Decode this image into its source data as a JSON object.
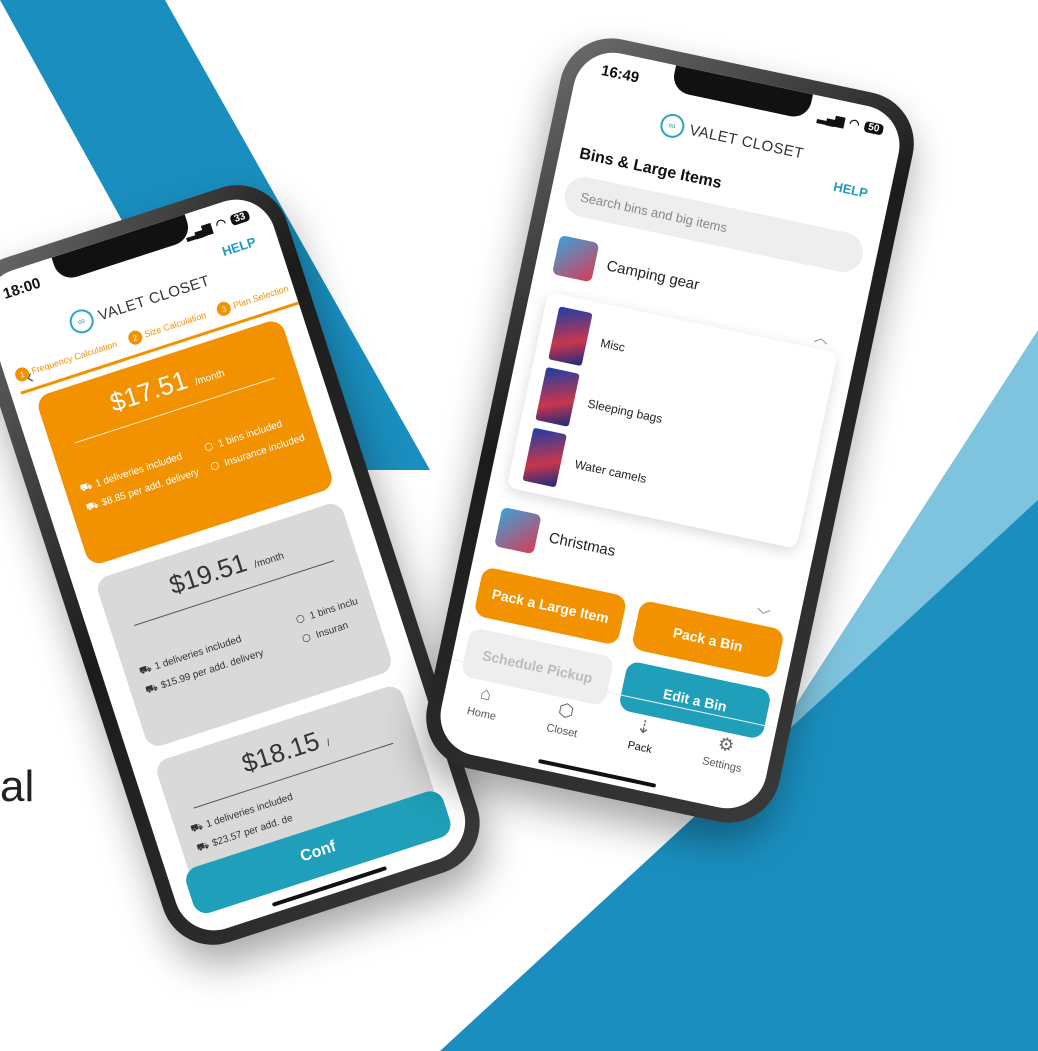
{
  "background": {
    "primary": "#1a8fbf",
    "secondary": "#7ec4de",
    "side_text": "al"
  },
  "left_phone": {
    "time": "18:00",
    "battery": "33",
    "help": "HELP",
    "logo_text": "VALET CLOSET",
    "back_icon": "chevron-left-icon",
    "steps": [
      {
        "num": "1",
        "label": "Frequency Calculation"
      },
      {
        "num": "2",
        "label": "Size Calculation"
      },
      {
        "num": "3",
        "label": "Plan Selection"
      }
    ],
    "plans": [
      {
        "price": "$17.51",
        "per": "/month",
        "deliveries": "1 deliveries included",
        "add_delivery": "$8.85 per add. delivery",
        "bins": "1 bins included",
        "insurance": "Insurance included",
        "selected": true
      },
      {
        "price": "$19.51",
        "per": "/month",
        "deliveries": "1 deliveries included",
        "add_delivery": "$15.99 per add. delivery",
        "bins": "1 bins inclu",
        "insurance": "Insuran",
        "selected": false
      },
      {
        "price": "$18.15",
        "per": "/",
        "deliveries": "1 deliveries included",
        "add_delivery": "$23.57 per add. de",
        "bins": "",
        "insurance": "",
        "selected": false
      }
    ],
    "confirm": "Conf"
  },
  "right_phone": {
    "time": "16:49",
    "battery": "50",
    "logo_text": "VALET CLOSET",
    "help": "HELP",
    "title": "Bins & Large Items",
    "search_placeholder": "Search bins and big items",
    "categories": [
      {
        "name": "Camping gear",
        "expanded": true
      },
      {
        "name": "Christmas",
        "expanded": false
      }
    ],
    "sub_items": [
      "Misc",
      "Sleeping bags",
      "Water camels"
    ],
    "buttons": {
      "pack_large": "Pack a Large Item",
      "pack_bin": "Pack a Bin",
      "schedule": "Schedule Pickup",
      "edit_bin": "Edit a Bin"
    },
    "tabs": [
      {
        "label": "Home",
        "icon": "home-icon"
      },
      {
        "label": "Closet",
        "icon": "box-icon"
      },
      {
        "label": "Pack",
        "icon": "pack-icon"
      },
      {
        "label": "Settings",
        "icon": "gear-icon"
      }
    ],
    "active_tab": "Pack"
  },
  "colors": {
    "orange": "#f39200",
    "teal": "#1f9fb9",
    "grey_card": "#d9d9d9"
  }
}
